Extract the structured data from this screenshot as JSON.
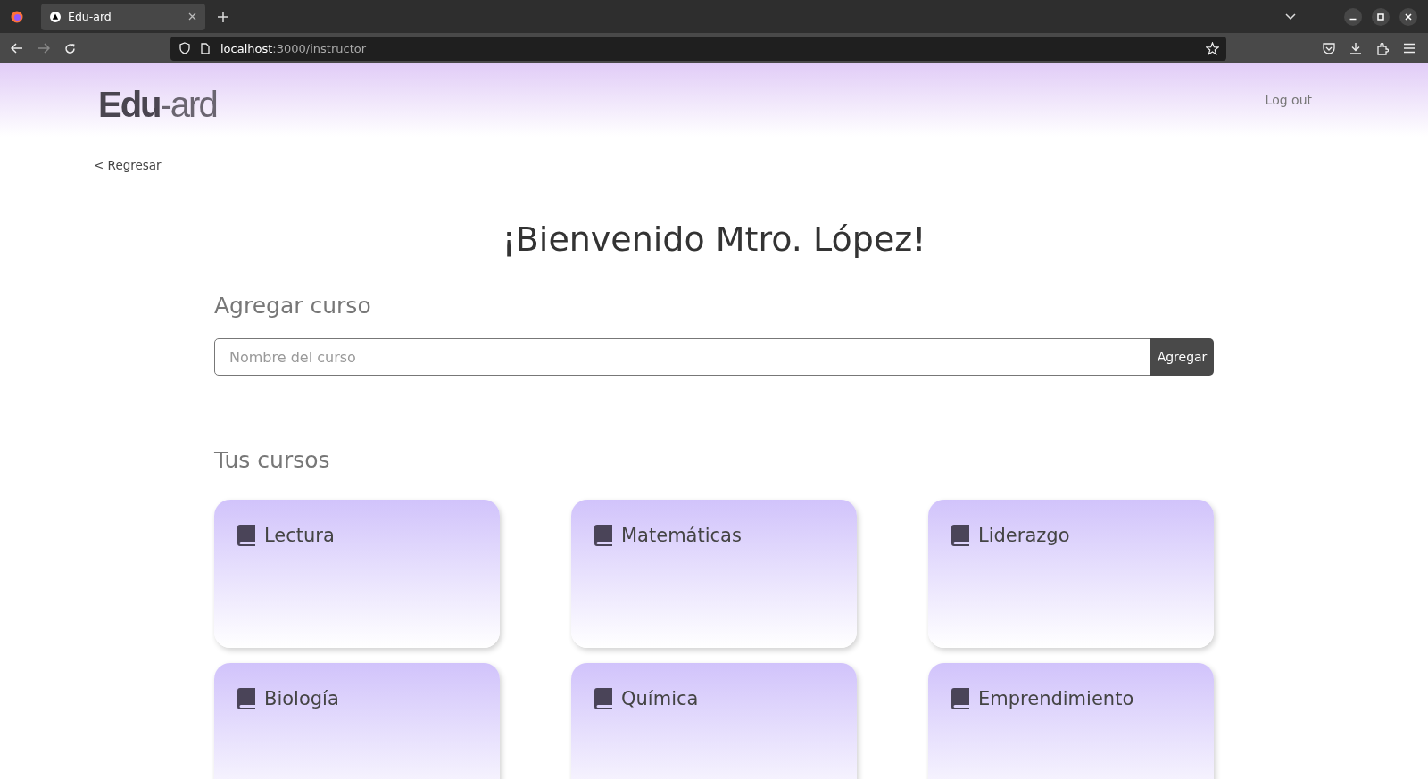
{
  "browser": {
    "tab_title": "Edu-ard",
    "url_host": "localhost",
    "url_path": ":3000/instructor"
  },
  "header": {
    "logo_bold": "Edu",
    "logo_light": "-ard",
    "logout": "Log out"
  },
  "back_link": "< Regresar",
  "title": "¡Bienvenido Mtro. López!",
  "add_course": {
    "heading": "Agregar curso",
    "placeholder": "Nombre del curso",
    "button": "Agregar"
  },
  "courses_heading": "Tus cursos",
  "courses": [
    {
      "name": "Lectura"
    },
    {
      "name": "Matemáticas"
    },
    {
      "name": "Liderazgo"
    },
    {
      "name": "Biología"
    },
    {
      "name": "Química"
    },
    {
      "name": "Emprendimiento"
    }
  ]
}
